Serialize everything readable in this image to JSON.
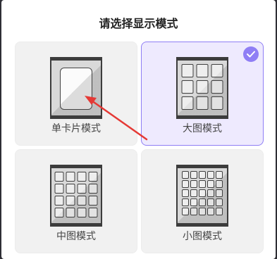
{
  "dialog": {
    "title": "请选择显示模式"
  },
  "modes": [
    {
      "label": "单卡片模式",
      "icon": "single-card-icon",
      "selected": false
    },
    {
      "label": "大图模式",
      "icon": "large-grid-icon",
      "selected": true
    },
    {
      "label": "中图模式",
      "icon": "medium-grid-icon",
      "selected": false
    },
    {
      "label": "小图模式",
      "icon": "small-grid-icon",
      "selected": false
    }
  ],
  "colors": {
    "accent": "#8f7ef5",
    "selected_bg": "#eeeafe",
    "card_bg": "#f1f1f1",
    "annotation_arrow": "#e53935"
  }
}
